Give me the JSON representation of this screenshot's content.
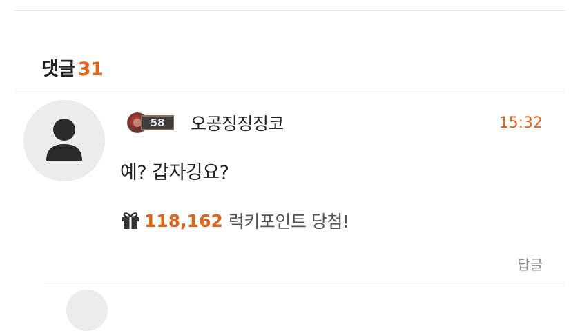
{
  "comments": {
    "header_label": "댓글",
    "count": "31"
  },
  "comment": {
    "level": "58",
    "nickname": "오공징징징코",
    "time": "15:32",
    "text": "예? 갑자깅요?",
    "lucky_points": "118,162",
    "lucky_text": "럭키포인트 당첨!",
    "reply_label": "답글",
    "avatar_icon": "user-silhouette-icon",
    "gift_icon": "gift-icon"
  },
  "colors": {
    "accent": "#e0641a",
    "avatar_bg": "#ececec",
    "avatar_fg": "#2b2b2b"
  }
}
